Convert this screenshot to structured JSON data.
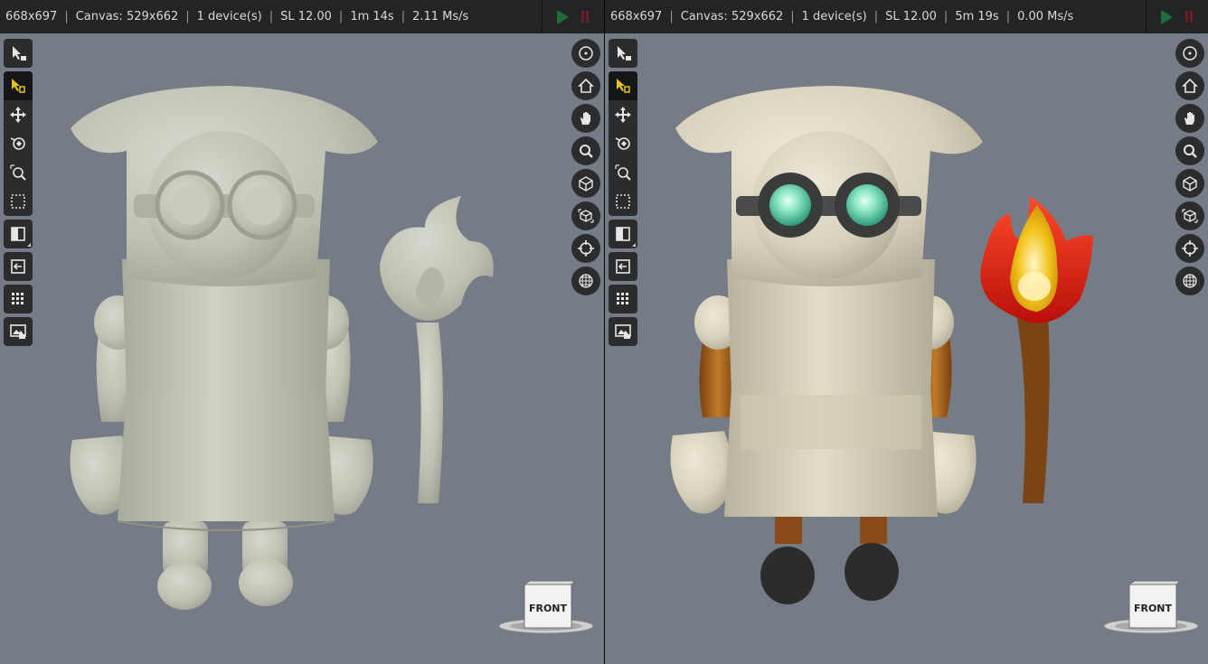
{
  "left": {
    "status": {
      "resolution": "668x697",
      "canvas": "Canvas: 529x662",
      "devices": "1 device(s)",
      "sl": "SL 12.00",
      "time": "1m 14s",
      "rate": "2.11 Ms/s"
    },
    "view_cube_label": "FRONT"
  },
  "right": {
    "status": {
      "resolution": "668x697",
      "canvas": "Canvas: 529x662",
      "devices": "1 device(s)",
      "sl": "SL 12.00",
      "time": "5m 19s",
      "rate": "0.00 Ms/s"
    },
    "view_cube_label": "FRONT"
  },
  "icons": {
    "left_toolbar": [
      "select-lock-icon",
      "select-object-icon",
      "move-icon",
      "light-icon",
      "zoom-region-icon",
      "marquee-select-icon",
      "split-view-icon",
      "exit-view-icon",
      "grid-icon",
      "screenshot-icon"
    ],
    "right_toolbar": [
      "target-icon",
      "home-icon",
      "pan-hand-icon",
      "zoom-icon",
      "cube-view-icon",
      "cube-perspective-icon",
      "crosshair-icon",
      "globe-grid-icon"
    ],
    "render_controls": [
      "play-icon",
      "pause-icon"
    ]
  },
  "colors": {
    "statusbar_bg": "#232425",
    "viewport_bg": "#767c86",
    "toolbar_bg": "#2b2c2e",
    "active_icon": "#e8c21e",
    "play": "#1f6b3c",
    "pause": "#6b1f24",
    "clay": "#c2c4b8",
    "cream": "#d8d4c0",
    "orange_arm": "#b06a22",
    "goggle_lens": "#8fe8c4",
    "torch_flame_red": "#e2261a",
    "torch_flame_yellow": "#f2c31a",
    "torch_handle": "#7a4414",
    "boots": "#2c2c2c"
  }
}
